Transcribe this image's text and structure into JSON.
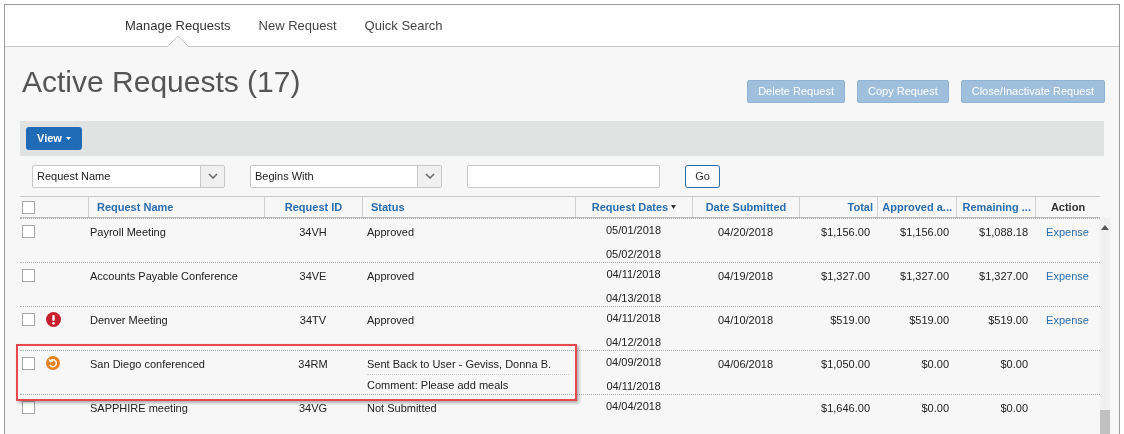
{
  "tabs": [
    {
      "label": "Manage Requests",
      "selected": true
    },
    {
      "label": "New Request",
      "selected": false
    },
    {
      "label": "Quick Search",
      "selected": false
    }
  ],
  "title": "Active Requests (17)",
  "actions": [
    {
      "label": "Delete Request",
      "disabled": true
    },
    {
      "label": "Copy Request",
      "disabled": true
    },
    {
      "label": "Close/Inactivate Request",
      "disabled": true
    }
  ],
  "toolbar": {
    "view_button": "View"
  },
  "filter": {
    "field": "Request Name",
    "operator": "Begins With",
    "go": "Go"
  },
  "table": {
    "select_all_checked": false,
    "columns": [
      {
        "label": "Request Name",
        "sorted": false
      },
      {
        "label": "Request ID",
        "sorted": false
      },
      {
        "label": "Status",
        "sorted": false
      },
      {
        "label": "Request Dates",
        "sorted": true
      },
      {
        "label": "Date Submitted",
        "sorted": false
      },
      {
        "label": "Total",
        "sorted": false
      },
      {
        "label": "Approved a...",
        "sorted": false
      },
      {
        "label": "Remaining ...",
        "sorted": false
      },
      {
        "label": "Action",
        "sorted": false
      }
    ],
    "rows": [
      {
        "checked": false,
        "kind": "plain",
        "name": "Payroll Meeting",
        "id": "34VH",
        "status": "Approved",
        "dates": [
          "05/01/2018",
          "05/02/2018"
        ],
        "submitted": "04/20/2018",
        "total": "$1,156.00",
        "approved": "$1,156.00",
        "remaining": "$1,088.18",
        "action": "Expense"
      },
      {
        "checked": false,
        "kind": "plain",
        "name": "Accounts Payable Conference",
        "id": "34VE",
        "status": "Approved",
        "dates": [
          "04/11/2018",
          "04/13/2018"
        ],
        "submitted": "04/19/2018",
        "total": "$1,327.00",
        "approved": "$1,327.00",
        "remaining": "$1,327.00",
        "action": "Expense"
      },
      {
        "checked": false,
        "kind": "alert",
        "name": "Denver Meeting",
        "id": "34TV",
        "status": "Approved",
        "dates": [
          "04/11/2018",
          "04/12/2018"
        ],
        "submitted": "04/10/2018",
        "total": "$519.00",
        "approved": "$519.00",
        "remaining": "$519.00",
        "action": "Expense"
      },
      {
        "checked": false,
        "kind": "returned",
        "name": "San Diego conferenced",
        "id": "34RM",
        "status": "Sent Back to User - Geviss, Donna B.",
        "comment": "Comment: Please add meals",
        "dates": [
          "04/09/2018",
          "04/11/2018"
        ],
        "submitted": "04/06/2018",
        "total": "$1,050.00",
        "approved": "$0.00",
        "remaining": "$0.00",
        "highlighted": true
      },
      {
        "checked": false,
        "kind": "plain",
        "name": "SAPPHIRE meeting",
        "id": "34VG",
        "status": "Not Submitted",
        "dates": [
          "04/04/2018"
        ],
        "total": "$1,646.00",
        "approved": "$0.00",
        "remaining": "$0.00"
      }
    ]
  }
}
